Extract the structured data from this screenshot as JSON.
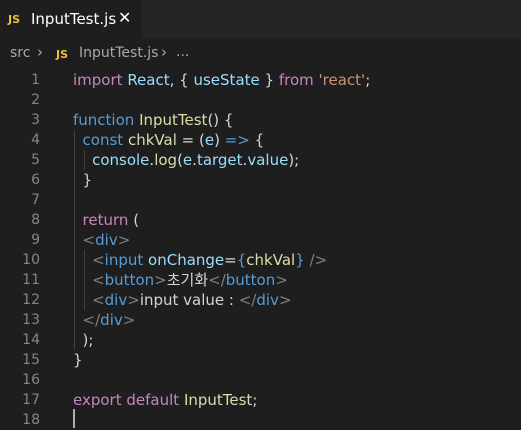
{
  "tab": {
    "badge": "JS",
    "title": "InputTest.js",
    "close_glyph": "✕"
  },
  "breadcrumb": {
    "folder": "src",
    "file_badge": "JS",
    "file": "InputTest.js",
    "ellipsis": "..."
  },
  "lines": [
    {
      "n": "1",
      "tokens": [
        [
          "ctrl",
          "import"
        ],
        [
          "punc",
          " "
        ],
        [
          "var",
          "React"
        ],
        [
          "punc",
          ", { "
        ],
        [
          "var",
          "useState"
        ],
        [
          "punc",
          " } "
        ],
        [
          "ctrl",
          "from"
        ],
        [
          "punc",
          " "
        ],
        [
          "str",
          "'react'"
        ],
        [
          "punc",
          ";"
        ]
      ]
    },
    {
      "n": "2",
      "tokens": []
    },
    {
      "n": "3",
      "tokens": [
        [
          "kw",
          "function"
        ],
        [
          "punc",
          " "
        ],
        [
          "fn",
          "InputTest"
        ],
        [
          "punc",
          "() {"
        ]
      ]
    },
    {
      "n": "4",
      "tokens": [
        [
          "punc",
          "  "
        ],
        [
          "kw",
          "const"
        ],
        [
          "punc",
          " "
        ],
        [
          "fn",
          "chkVal"
        ],
        [
          "punc",
          " = ("
        ],
        [
          "var",
          "e"
        ],
        [
          "punc",
          ") "
        ],
        [
          "kw",
          "=>"
        ],
        [
          "punc",
          " {"
        ]
      ]
    },
    {
      "n": "5",
      "tokens": [
        [
          "punc",
          "    "
        ],
        [
          "var",
          "console"
        ],
        [
          "punc",
          "."
        ],
        [
          "fn",
          "log"
        ],
        [
          "punc",
          "("
        ],
        [
          "var",
          "e"
        ],
        [
          "punc",
          "."
        ],
        [
          "var",
          "target"
        ],
        [
          "punc",
          "."
        ],
        [
          "var",
          "value"
        ],
        [
          "punc",
          ");"
        ]
      ]
    },
    {
      "n": "6",
      "tokens": [
        [
          "punc",
          "  }"
        ]
      ]
    },
    {
      "n": "7",
      "tokens": []
    },
    {
      "n": "8",
      "tokens": [
        [
          "punc",
          "  "
        ],
        [
          "ctrl",
          "return"
        ],
        [
          "punc",
          " ("
        ]
      ]
    },
    {
      "n": "9",
      "tokens": [
        [
          "punc",
          "  "
        ],
        [
          "br",
          "<"
        ],
        [
          "tag",
          "div"
        ],
        [
          "br",
          ">"
        ]
      ]
    },
    {
      "n": "10",
      "tokens": [
        [
          "punc",
          "    "
        ],
        [
          "br",
          "<"
        ],
        [
          "tag",
          "input"
        ],
        [
          "punc",
          " "
        ],
        [
          "attr",
          "onChange"
        ],
        [
          "punc",
          "="
        ],
        [
          "brace",
          "{"
        ],
        [
          "fn",
          "chkVal"
        ],
        [
          "brace",
          "}"
        ],
        [
          "punc",
          " "
        ],
        [
          "br",
          "/>"
        ]
      ]
    },
    {
      "n": "11",
      "tokens": [
        [
          "punc",
          "    "
        ],
        [
          "br",
          "<"
        ],
        [
          "tag",
          "button"
        ],
        [
          "br",
          ">"
        ],
        [
          "jsx-text",
          "초기화"
        ],
        [
          "br",
          "</"
        ],
        [
          "tag",
          "button"
        ],
        [
          "br",
          ">"
        ]
      ]
    },
    {
      "n": "12",
      "tokens": [
        [
          "punc",
          "    "
        ],
        [
          "br",
          "<"
        ],
        [
          "tag",
          "div"
        ],
        [
          "br",
          ">"
        ],
        [
          "jsx-text",
          "input value : "
        ],
        [
          "br",
          "</"
        ],
        [
          "tag",
          "div"
        ],
        [
          "br",
          ">"
        ]
      ]
    },
    {
      "n": "13",
      "tokens": [
        [
          "punc",
          "  "
        ],
        [
          "br",
          "</"
        ],
        [
          "tag",
          "div"
        ],
        [
          "br",
          ">"
        ]
      ]
    },
    {
      "n": "14",
      "tokens": [
        [
          "punc",
          "  );"
        ]
      ]
    },
    {
      "n": "15",
      "tokens": [
        [
          "punc",
          "}"
        ]
      ]
    },
    {
      "n": "16",
      "tokens": []
    },
    {
      "n": "17",
      "tokens": [
        [
          "ctrl",
          "export"
        ],
        [
          "punc",
          " "
        ],
        [
          "ctrl",
          "default"
        ],
        [
          "punc",
          " "
        ],
        [
          "fn",
          "InputTest"
        ],
        [
          "punc",
          ";"
        ]
      ]
    },
    {
      "n": "18",
      "tokens": []
    }
  ],
  "colors": {
    "background": "#1e1e1e",
    "tabbar": "#252526",
    "js_badge": "#e8c23a",
    "keyword": "#569cd6",
    "control": "#c586c0",
    "function": "#dcdcaa",
    "variable": "#9cdcfe",
    "string": "#ce9178"
  }
}
